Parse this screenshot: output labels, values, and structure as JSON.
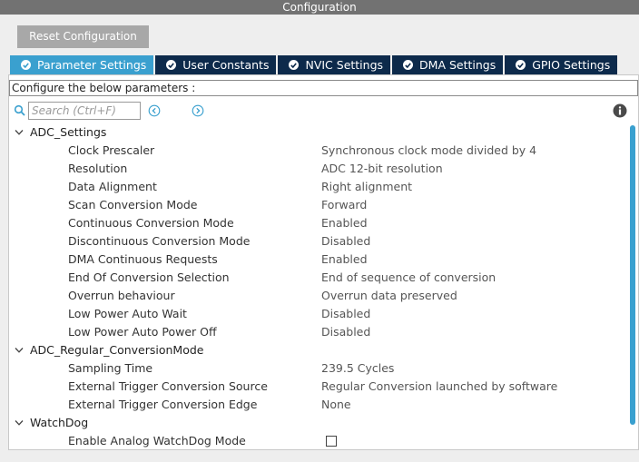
{
  "window": {
    "title": "Configuration"
  },
  "toolbar": {
    "reset_label": "Reset Configuration"
  },
  "tabs": [
    {
      "label": "Parameter Settings",
      "active": true
    },
    {
      "label": "User Constants",
      "active": false
    },
    {
      "label": "NVIC Settings",
      "active": false
    },
    {
      "label": "DMA Settings",
      "active": false
    },
    {
      "label": "GPIO Settings",
      "active": false
    }
  ],
  "panel": {
    "configure_text": "Configure the below parameters :"
  },
  "search": {
    "placeholder": "Search (Ctrl+F)",
    "value": ""
  },
  "groups": [
    {
      "label": "ADC_Settings",
      "params": [
        {
          "name": "Clock Prescaler",
          "value": "Synchronous clock mode divided by 4"
        },
        {
          "name": "Resolution",
          "value": "ADC 12-bit resolution"
        },
        {
          "name": "Data Alignment",
          "value": "Right alignment"
        },
        {
          "name": "Scan Conversion Mode",
          "value": "Forward"
        },
        {
          "name": "Continuous Conversion Mode",
          "value": "Enabled"
        },
        {
          "name": "Discontinuous Conversion Mode",
          "value": "Disabled"
        },
        {
          "name": "DMA Continuous Requests",
          "value": "Enabled"
        },
        {
          "name": "End Of Conversion Selection",
          "value": "End of sequence of conversion"
        },
        {
          "name": "Overrun behaviour",
          "value": "Overrun data preserved"
        },
        {
          "name": "Low Power Auto Wait",
          "value": "Disabled"
        },
        {
          "name": "Low Power Auto Power Off",
          "value": "Disabled"
        }
      ]
    },
    {
      "label": "ADC_Regular_ConversionMode",
      "params": [
        {
          "name": "Sampling Time",
          "value": "239.5 Cycles"
        },
        {
          "name": "External Trigger Conversion Source",
          "value": "Regular Conversion launched by software"
        },
        {
          "name": "External Trigger Conversion Edge",
          "value": "None"
        }
      ]
    },
    {
      "label": "WatchDog",
      "params": [
        {
          "name": "Enable Analog WatchDog Mode",
          "value": "",
          "checkbox": true,
          "checked": false
        }
      ]
    }
  ],
  "colors": {
    "title_bg": "#727272",
    "tab_bg": "#0d2a4b",
    "tab_active_bg": "#3aa0cf",
    "accent": "#3aa0cf"
  },
  "icons": {
    "search": "search-icon",
    "prev": "chevron-left-circle-icon",
    "next": "chevron-right-circle-icon",
    "info": "info-icon",
    "tab_check": "check-circle-icon",
    "expand": "chevron-down-icon"
  }
}
